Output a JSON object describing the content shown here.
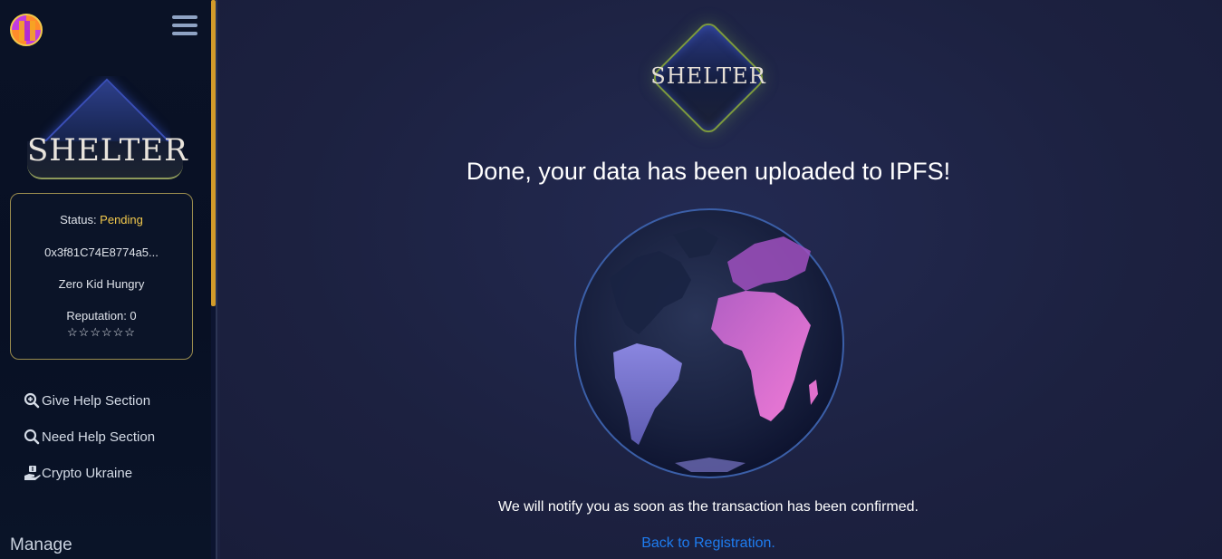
{
  "sidebar": {
    "logo_text": "SHELTER",
    "status_label": "Status: ",
    "status_value": "Pending",
    "wallet_address": "0x3f81C74E8774a5...",
    "name": "Zero Kid Hungry",
    "reputation": "Reputation: 0",
    "rating": {
      "value": 0,
      "max": 6,
      "display": "☆☆☆☆☆☆"
    },
    "nav": [
      {
        "label": "Give Help Section",
        "icon": "search-plus-icon"
      },
      {
        "label": "Need Help Section",
        "icon": "search-icon"
      },
      {
        "label": "Crypto Ukraine",
        "icon": "hand-donate-icon"
      }
    ],
    "manage_label": "Manage"
  },
  "main": {
    "logo_text": "SHELTER",
    "headline": "Done, your data has been uploaded to IPFS!",
    "notify": "We will notify you as soon as the transaction has been confirmed.",
    "back_link": "Back to Registration."
  },
  "colors": {
    "accent_gold": "#f2c94c",
    "link_blue": "#1e7cf0",
    "background": "#1c2140"
  }
}
